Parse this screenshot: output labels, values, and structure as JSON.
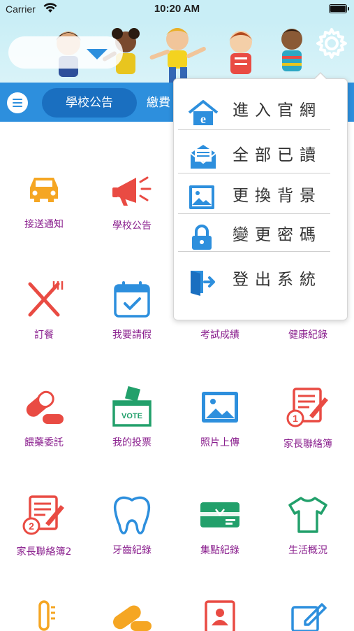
{
  "status_bar": {
    "carrier": "Carrier",
    "time": "10:20 AM"
  },
  "tabs": {
    "active": "學校公告",
    "next": "繳費"
  },
  "grid": [
    {
      "label": "接送通知",
      "icon": "car-icon"
    },
    {
      "label": "學校公告",
      "icon": "megaphone-icon"
    },
    {
      "label": "",
      "icon": ""
    },
    {
      "label": "",
      "icon": ""
    },
    {
      "label": "訂餐",
      "icon": "fork-knife-icon"
    },
    {
      "label": "我要請假",
      "icon": "calendar-check-icon"
    },
    {
      "label": "考試成績",
      "icon": ""
    },
    {
      "label": "健康紀錄",
      "icon": ""
    },
    {
      "label": "餵藥委託",
      "icon": "pill-icon"
    },
    {
      "label": "我的投票",
      "icon": "vote-box-icon"
    },
    {
      "label": "照片上傳",
      "icon": "photo-icon"
    },
    {
      "label": "家長聯絡簿",
      "icon": "notebook-1-icon"
    },
    {
      "label": "家長聯絡簿2",
      "icon": "notebook-2-icon"
    },
    {
      "label": "牙齒紀錄",
      "icon": "tooth-icon"
    },
    {
      "label": "集點紀錄",
      "icon": "ticket-icon"
    },
    {
      "label": "生活概況",
      "icon": "tshirt-icon"
    }
  ],
  "vote_text": "VOTE",
  "popup_menu": [
    {
      "label": "進入官網",
      "icon": "home-web-icon"
    },
    {
      "label": "全部已讀",
      "icon": "mail-read-icon"
    },
    {
      "label": "更換背景",
      "icon": "image-icon"
    },
    {
      "label": "變更密碼",
      "icon": "lock-icon"
    },
    {
      "label": "登出系統",
      "icon": "logout-door-icon"
    }
  ],
  "colors": {
    "primary_blue": "#2d8fdd",
    "label_purple": "#8a1f8e",
    "icon_red": "#e94b43",
    "icon_orange": "#f5a623",
    "icon_green": "#22a06b",
    "icon_blue": "#2d8fdd"
  }
}
